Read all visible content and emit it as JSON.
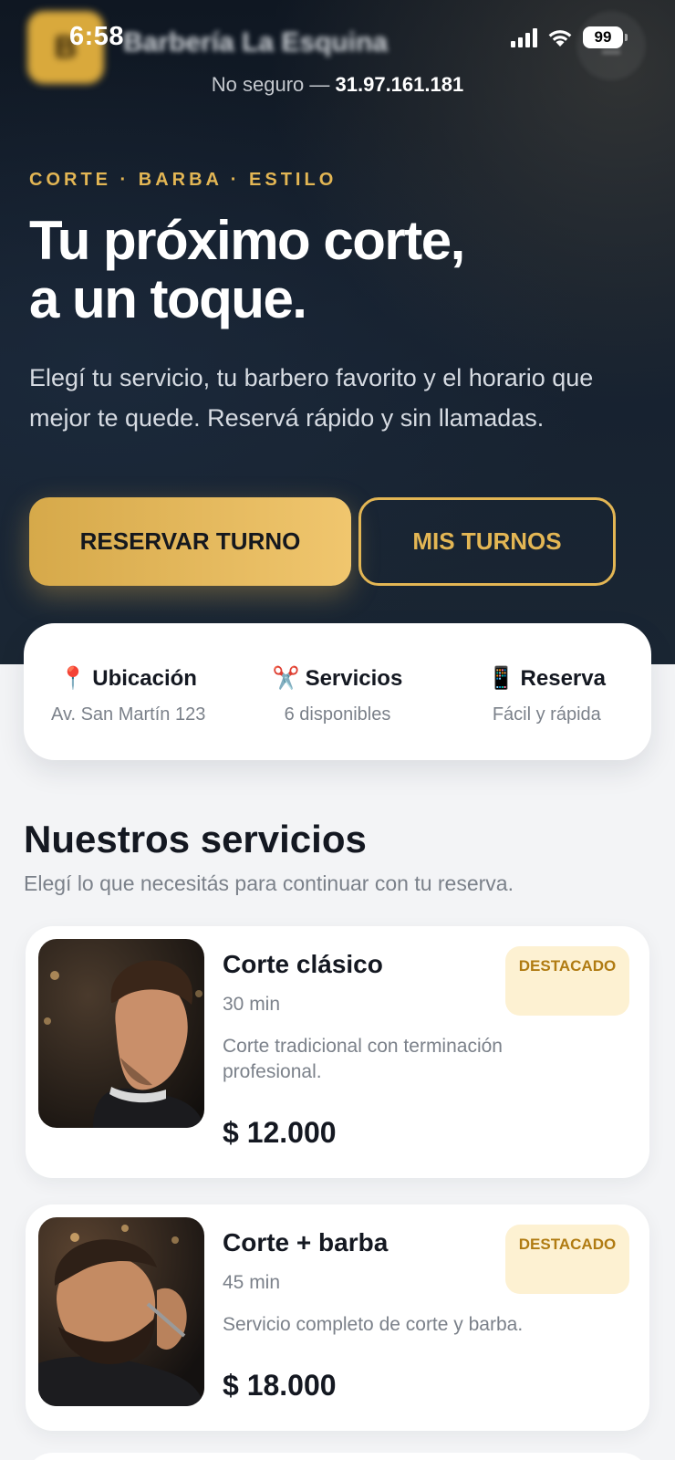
{
  "status": {
    "time": "6:58",
    "battery": "99"
  },
  "browser": {
    "security_label": "No seguro —",
    "host": "31.97.161.181"
  },
  "header": {
    "logo_letter": "B",
    "brand": "Barbería La Esquina"
  },
  "hero": {
    "eyebrow": "CORTE · BARBA · ESTILO",
    "title_line1": "Tu próximo corte,",
    "title_line2": "a un toque.",
    "subtitle": "Elegí tu servicio, tu barbero favorito y el horario que mejor te quede. Reservá rápido y sin llamadas.",
    "primary_button": "RESERVAR TURNO",
    "secondary_button": "MIS TURNOS"
  },
  "info": [
    {
      "icon": "📍",
      "icon_name": "location-pin-icon",
      "title": "Ubicación",
      "subtitle": "Av. San Martín 123"
    },
    {
      "icon": "✂️",
      "icon_name": "scissors-icon",
      "title": "Servicios",
      "subtitle": "6 disponibles"
    },
    {
      "icon": "📱",
      "icon_name": "phone-icon",
      "title": "Reserva",
      "subtitle": "Fácil y rápida"
    }
  ],
  "services": {
    "title": "Nuestros servicios",
    "subtitle": "Elegí lo que necesitás para continuar con tu reserva.",
    "items": [
      {
        "name": "Corte clásico",
        "duration": "30 min",
        "description": "Corte tradicional con terminación profesional.",
        "price": "$ 12.000",
        "badge": "DESTACADO"
      },
      {
        "name": "Corte + barba",
        "duration": "45 min",
        "description": "Servicio completo de corte y barba.",
        "price": "$ 18.000",
        "badge": "DESTACADO"
      }
    ]
  },
  "colors": {
    "accent_gold": "#e3b654",
    "hero_bg": "#0f1722",
    "badge_bg": "#fdf1d2"
  }
}
